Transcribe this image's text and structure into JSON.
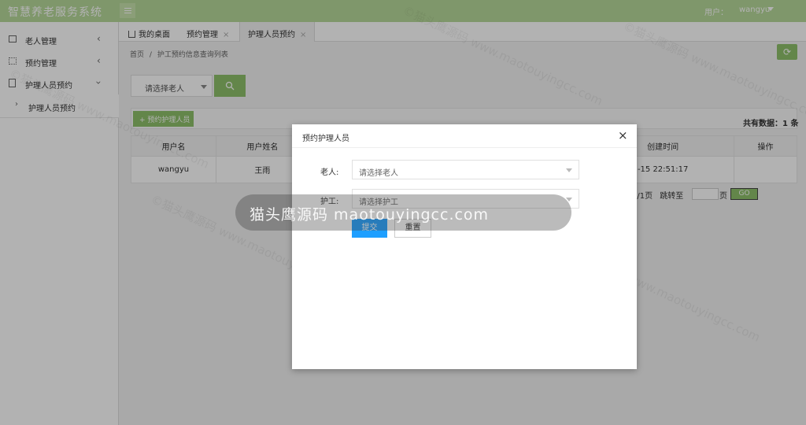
{
  "header": {
    "title": "智慧养老服务系统",
    "user_label": "用户：",
    "user_name": "wangyu"
  },
  "sidebar": {
    "items": [
      {
        "label": "老人管理",
        "icon": "calendar-icon"
      },
      {
        "label": "预约管理",
        "icon": "grid-icon"
      },
      {
        "label": "护理人员预约",
        "icon": "document-icon"
      }
    ],
    "sub_item": "护理人员预约"
  },
  "tabs": [
    {
      "label": "我的桌面"
    },
    {
      "label": "预约管理",
      "close": "×"
    },
    {
      "label": "护理人员预约",
      "close": "×"
    }
  ],
  "breadcrumb": {
    "home": "首页",
    "separator": "/",
    "current": "护工预约信息查询列表"
  },
  "search": {
    "select_placeholder": "请选择老人"
  },
  "toolbar": {
    "add_label": "+ 预约护理人员",
    "total_label": "共有数据：1 条"
  },
  "table": {
    "headers": [
      "用户名",
      "用户姓名",
      "",
      "",
      "",
      "",
      "创建时间",
      "操作"
    ],
    "rows": [
      [
        "wangyu",
        "王雨",
        "",
        "",
        "",
        "",
        "-15 22:51:17",
        ""
      ]
    ]
  },
  "pager": {
    "info": "1/1页",
    "jump_label": "跳转至",
    "page_suffix": "页",
    "go_label": "GO"
  },
  "modal": {
    "title": "预约护理人员",
    "close": "×",
    "elder_label": "老人:",
    "elder_placeholder": "请选择老人",
    "worker_label": "护工:",
    "worker_placeholder": "请选择护工",
    "submit_label": "提交",
    "reset_label": "重置"
  },
  "watermark": {
    "toast_text": "猫头鹰源码 maotouyingcc.com",
    "tile_text": "©猫头鹰源码 www.maotouyingcc.com"
  },
  "colors": {
    "header_bg": "#b7d99a",
    "accent_green": "#8fc16b",
    "primary_blue": "#1e9fff"
  }
}
